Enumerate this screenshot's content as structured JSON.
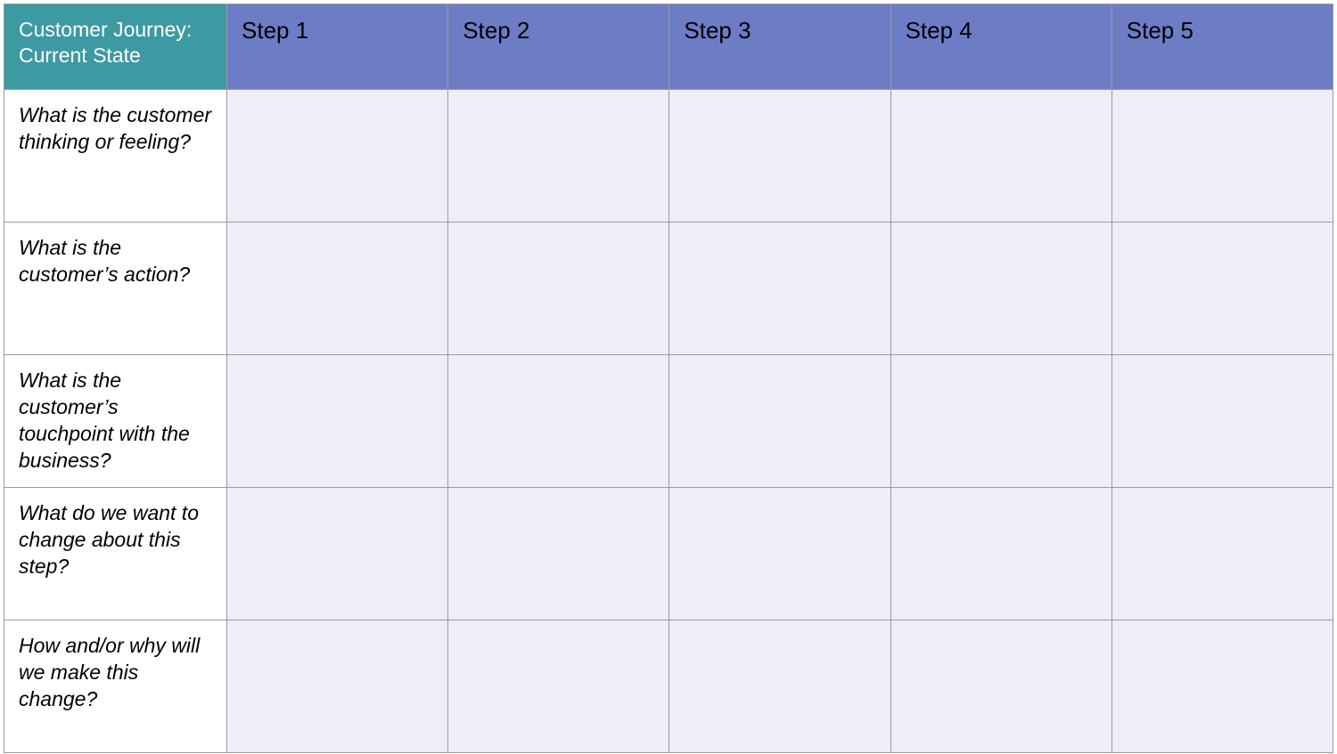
{
  "table": {
    "corner_label": "Customer Journey: Current State",
    "columns": [
      {
        "label": "Step 1"
      },
      {
        "label": "Step 2"
      },
      {
        "label": "Step 3"
      },
      {
        "label": "Step 4"
      },
      {
        "label": "Step 5"
      }
    ],
    "rows": [
      {
        "label": "What is the customer thinking or feeling?",
        "cells": [
          "",
          "",
          "",
          "",
          ""
        ]
      },
      {
        "label": "What is the customer’s action?",
        "cells": [
          "",
          "",
          "",
          "",
          ""
        ]
      },
      {
        "label": "What is the customer’s touchpoint with the business?",
        "cells": [
          "",
          "",
          "",
          "",
          ""
        ]
      },
      {
        "label": "What do we want to change about this step?",
        "cells": [
          "",
          "",
          "",
          "",
          ""
        ]
      },
      {
        "label": "How and/or why will we make this change?",
        "cells": [
          "",
          "",
          "",
          "",
          ""
        ]
      }
    ]
  }
}
